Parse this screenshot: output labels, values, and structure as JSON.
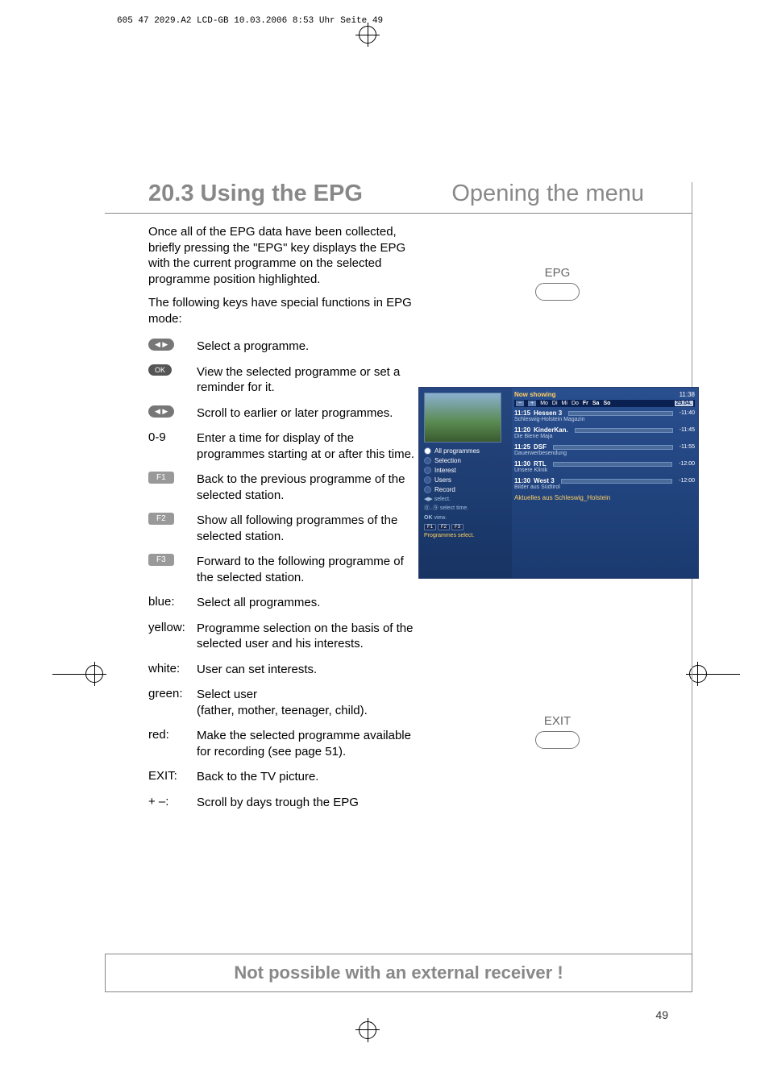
{
  "header": "605 47 2029.A2 LCD-GB  10.03.2006  8:53 Uhr  Seite 49",
  "title_left": "20.3 Using the EPG",
  "title_right": "Opening the menu",
  "intro": {
    "p1": "Once all of the EPG data have been collected, briefly pressing the \"EPG\" key displays the EPG with the current programme on the selected programme position highlighted.",
    "p2": "The following keys have special functions in EPG mode:"
  },
  "buttons": {
    "epg": "EPG",
    "exit": "EXIT"
  },
  "keys": [
    {
      "label_type": "icon",
      "icon": "nav-lr",
      "desc": "Select a programme."
    },
    {
      "label_type": "icon",
      "icon": "ok",
      "desc": "View the selected programme or set a reminder for it."
    },
    {
      "label_type": "icon",
      "icon": "nav-ud",
      "desc": "Scroll to earlier or later programmes."
    },
    {
      "label_type": "text",
      "label": "0-9",
      "desc": "Enter a time for display of the programmes starting at or after this time."
    },
    {
      "label_type": "fkey",
      "label": "F1",
      "desc": "Back to the previous programme of the selected station."
    },
    {
      "label_type": "fkey",
      "label": "F2",
      "desc": "Show all following programmes of the selected station."
    },
    {
      "label_type": "fkey",
      "label": "F3",
      "desc": "Forward to the following programme of the selected station."
    },
    {
      "label_type": "text",
      "label": "blue:",
      "desc": "Select all programmes."
    },
    {
      "label_type": "text",
      "label": "yellow:",
      "desc": "Programme selection on the basis of the selected user and his interests."
    },
    {
      "label_type": "text",
      "label": "white:",
      "desc": "User can set interests."
    },
    {
      "label_type": "text",
      "label": "green:",
      "desc": "Select user\n(father, mother, teenager, child)."
    },
    {
      "label_type": "text",
      "label": "red:",
      "desc": "Make the selected programme available for recording (see page 51)."
    },
    {
      "label_type": "text",
      "label": "EXIT:",
      "desc": "Back to the TV picture."
    },
    {
      "label_type": "text",
      "label": "+ –:",
      "desc": "Scroll by days trough the EPG"
    }
  ],
  "epg": {
    "menu": [
      "All programmes",
      "Selection",
      "Interest",
      "Users",
      "Record"
    ],
    "hints": {
      "select": "select.",
      "select_time": "select time.",
      "ok": "view."
    },
    "fkeys": [
      "F1",
      "F2",
      "F3"
    ],
    "prog_select": "Programmes select.",
    "now": "Now showing",
    "time": "11:38",
    "days": [
      "−",
      "+",
      "Mo",
      "Di",
      "Mi",
      "Do",
      "Fr",
      "Sa",
      "So"
    ],
    "date": "29.04.",
    "programmes": [
      {
        "t": "11:15",
        "ch": "Hessen 3",
        "title": "Schleswig-Holstein Magazin",
        "end": "-11:40",
        "fill": 85
      },
      {
        "t": "11:20",
        "ch": "KinderKan.",
        "title": "Die Biene Maja",
        "end": "-11:45",
        "fill": 70
      },
      {
        "t": "11:25",
        "ch": "DSF",
        "title": "Dauerwerbesendung",
        "end": "-11:55",
        "fill": 45
      },
      {
        "t": "11:30",
        "ch": "RTL",
        "title": "Unsere Klinik",
        "end": "-12:00",
        "fill": 30
      },
      {
        "t": "11:30",
        "ch": "West 3",
        "title": "Bilder aus Südtirol",
        "end": "-12:00",
        "fill": 30
      }
    ],
    "bottom": "Aktuelles aus Schleswig_Holstein"
  },
  "bottom_box": "Not possible with an external receiver !",
  "page_number": "49"
}
